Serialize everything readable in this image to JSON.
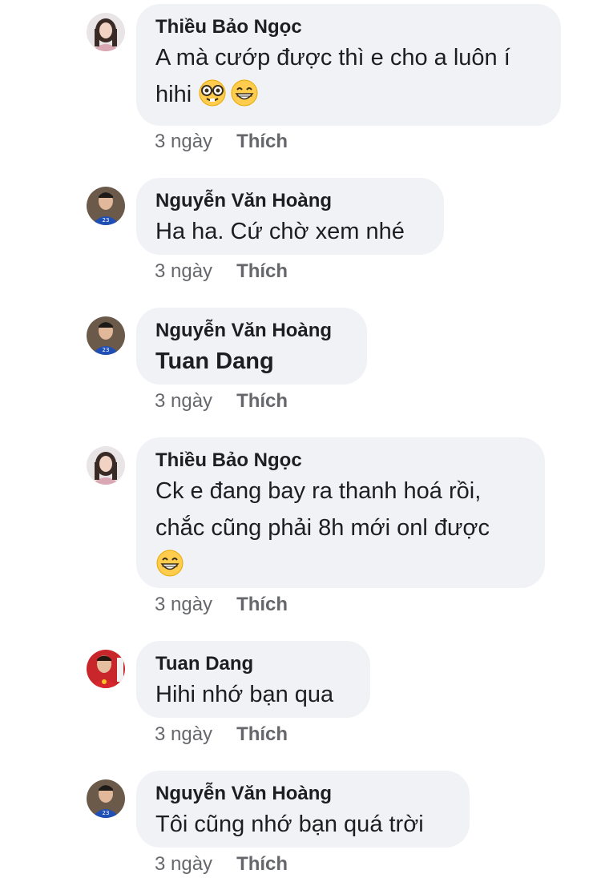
{
  "comments": [
    {
      "author": "Thiều Bảo Ngọc",
      "line1": "A mà cướp được thì e cho a luôn í",
      "line2": "hihi",
      "emojis": [
        "nerd-face",
        "grinning-face"
      ],
      "time": "3 ngày",
      "like": "Thích"
    },
    {
      "author": "Nguyễn Văn Hoàng",
      "line1": "Ha ha. Cứ chờ xem nhé",
      "time": "3 ngày",
      "like": "Thích"
    },
    {
      "author": "Nguyễn Văn Hoàng",
      "line1": "Tuan Dang",
      "time": "3 ngày",
      "like": "Thích"
    },
    {
      "author": "Thiều Bảo Ngọc",
      "line1": "Ck e đang bay ra thanh hoá rồi,",
      "line2": "chắc cũng phải 8h mới onl được",
      "emojis": [
        "grinning-face"
      ],
      "time": "3 ngày",
      "like": "Thích"
    },
    {
      "author": "Tuan Dang",
      "line1": "Hihi nhớ bạn qua",
      "time": "3 ngày",
      "like": "Thích"
    },
    {
      "author": "Nguyễn Văn Hoàng",
      "line1": "Tôi cũng nhớ bạn quá trời",
      "time": "3 ngày",
      "like": "Thích"
    }
  ],
  "colors": {
    "bubble": "#f0f2f5",
    "text": "#1c1e21",
    "meta": "#65676b"
  }
}
